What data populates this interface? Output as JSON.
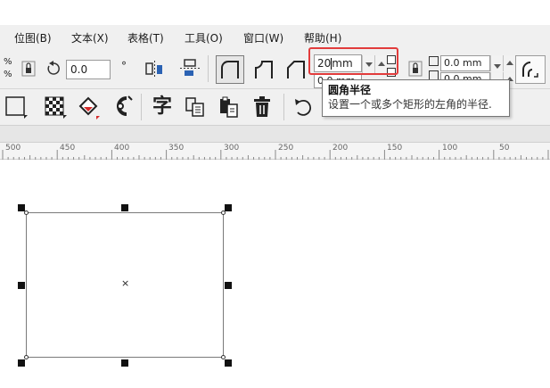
{
  "menu": {
    "items": [
      {
        "label": "位图(B)"
      },
      {
        "label": "文本(X)"
      },
      {
        "label": "表格(T)"
      },
      {
        "label": "工具(O)"
      },
      {
        "label": "窗口(W)"
      },
      {
        "label": "帮助(H)"
      }
    ]
  },
  "propbar": {
    "percent_top": "%",
    "percent_bottom": "%",
    "rotation_value": "0.0",
    "corner_radius_value": "20",
    "corner_radius_unit": "mm",
    "corner_small_top_value": "0.0 mm",
    "corner_small_bottom_value": "0.0 mm",
    "corner_left_bottom_value": "0.0 mm"
  },
  "tooltip": {
    "title": "圆角半径",
    "description": "设置一个或多个矩形的左角的半径."
  },
  "ruler": {
    "labels": [
      "500",
      "450",
      "400",
      "350",
      "300",
      "250",
      "200",
      "150",
      "100",
      "50"
    ]
  },
  "colors": {
    "highlight": "#e23c3c",
    "toolbar_bg": "#f0f0f0"
  }
}
